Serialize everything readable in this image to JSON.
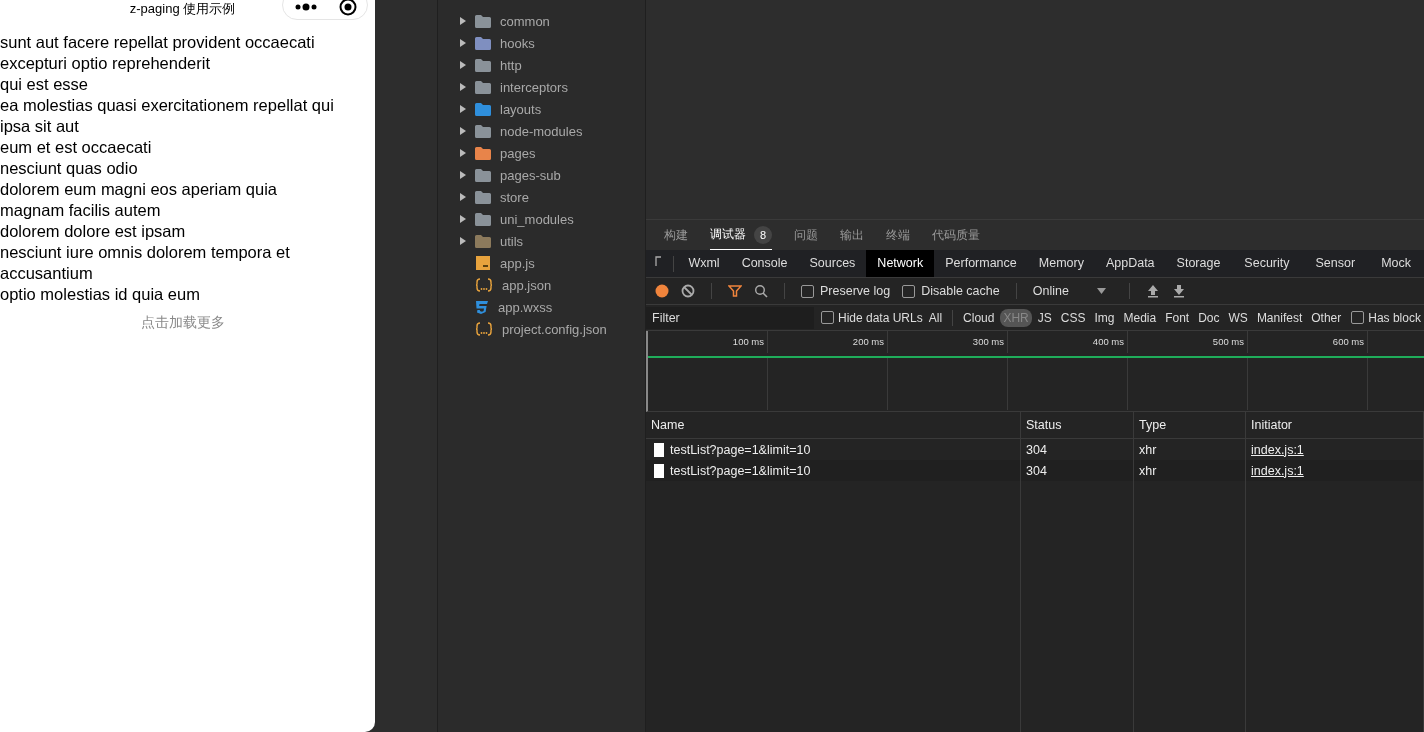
{
  "phone": {
    "title": "z-paging 使用示例",
    "items": [
      "sunt aut facere repellat provident occaecati excepturi optio reprehenderit",
      "qui est esse",
      "ea molestias quasi exercitationem repellat qui ipsa sit aut",
      "eum et est occaecati",
      "nesciunt quas odio",
      "dolorem eum magni eos aperiam quia",
      "magnam facilis autem",
      "dolorem dolore est ipsam",
      "nesciunt iure omnis dolorem tempora et accusantium",
      "optio molestias id quia eum"
    ],
    "load_more": "点击加载更多"
  },
  "file_tree": [
    {
      "kind": "folder",
      "name": "common",
      "color": "#8a9299"
    },
    {
      "kind": "folder",
      "name": "hooks",
      "color": "#7f8fc0"
    },
    {
      "kind": "folder",
      "name": "http",
      "color": "#8a9299"
    },
    {
      "kind": "folder",
      "name": "interceptors",
      "color": "#8a9299"
    },
    {
      "kind": "folder",
      "name": "layouts",
      "color": "#2f8fdc"
    },
    {
      "kind": "folder",
      "name": "node-modules",
      "color": "#8a9299"
    },
    {
      "kind": "folder",
      "name": "pages",
      "color": "#e8844a"
    },
    {
      "kind": "folder",
      "name": "pages-sub",
      "color": "#8a9299"
    },
    {
      "kind": "folder",
      "name": "store",
      "color": "#8a9299"
    },
    {
      "kind": "folder",
      "name": "uni_modules",
      "color": "#8a9299"
    },
    {
      "kind": "folder",
      "name": "utils",
      "color": "#8c7a5c"
    },
    {
      "kind": "js",
      "name": "app.js"
    },
    {
      "kind": "json",
      "name": "app.json"
    },
    {
      "kind": "css",
      "name": "app.wxss"
    },
    {
      "kind": "json",
      "name": "project.config.json"
    }
  ],
  "panel_tabs": [
    {
      "label": "构建",
      "selected": false
    },
    {
      "label": "调试器",
      "selected": true,
      "badge": "8"
    },
    {
      "label": "问题",
      "selected": false
    },
    {
      "label": "输出",
      "selected": false
    },
    {
      "label": "终端",
      "selected": false
    },
    {
      "label": "代码质量",
      "selected": false
    }
  ],
  "devtools_tabs": [
    {
      "label": "Wxml",
      "selected": false
    },
    {
      "label": "Console",
      "selected": false
    },
    {
      "label": "Sources",
      "selected": false
    },
    {
      "label": "Network",
      "selected": true
    },
    {
      "label": "Performance",
      "selected": false
    },
    {
      "label": "Memory",
      "selected": false
    },
    {
      "label": "AppData",
      "selected": false
    },
    {
      "label": "Storage",
      "selected": false
    },
    {
      "label": "Security",
      "selected": false
    },
    {
      "label": "Sensor",
      "selected": false
    },
    {
      "label": "Mock",
      "selected": false
    }
  ],
  "toolbar": {
    "preserve_log": {
      "label": "Preserve log",
      "checked": false
    },
    "disable_cache": {
      "label": "Disable cache",
      "checked": false
    },
    "throttle": "Online"
  },
  "filter": {
    "placeholder": "Filter",
    "hide_data_urls": {
      "label": "Hide data URLs",
      "checked": false
    },
    "types": [
      {
        "label": "All",
        "selected": false
      },
      {
        "label": "Cloud",
        "selected": false
      },
      {
        "label": "XHR",
        "selected": true
      },
      {
        "label": "JS",
        "selected": false
      },
      {
        "label": "CSS",
        "selected": false
      },
      {
        "label": "Img",
        "selected": false
      },
      {
        "label": "Media",
        "selected": false
      },
      {
        "label": "Font",
        "selected": false
      },
      {
        "label": "Doc",
        "selected": false
      },
      {
        "label": "WS",
        "selected": false
      },
      {
        "label": "Manifest",
        "selected": false
      },
      {
        "label": "Other",
        "selected": false
      }
    ],
    "has_blocked": {
      "label": "Has block",
      "checked": false
    }
  },
  "timeline": {
    "ticks": [
      "100 ms",
      "200 ms",
      "300 ms",
      "400 ms",
      "500 ms",
      "600 ms"
    ]
  },
  "table": {
    "columns": [
      "Name",
      "Status",
      "Type",
      "Initiator"
    ],
    "rows": [
      {
        "name": "testList?page=1&limit=10",
        "status": "304",
        "type": "xhr",
        "initiator": "index.js:1"
      },
      {
        "name": "testList?page=1&limit=10",
        "status": "304",
        "type": "xhr",
        "initiator": "index.js:1"
      }
    ]
  }
}
